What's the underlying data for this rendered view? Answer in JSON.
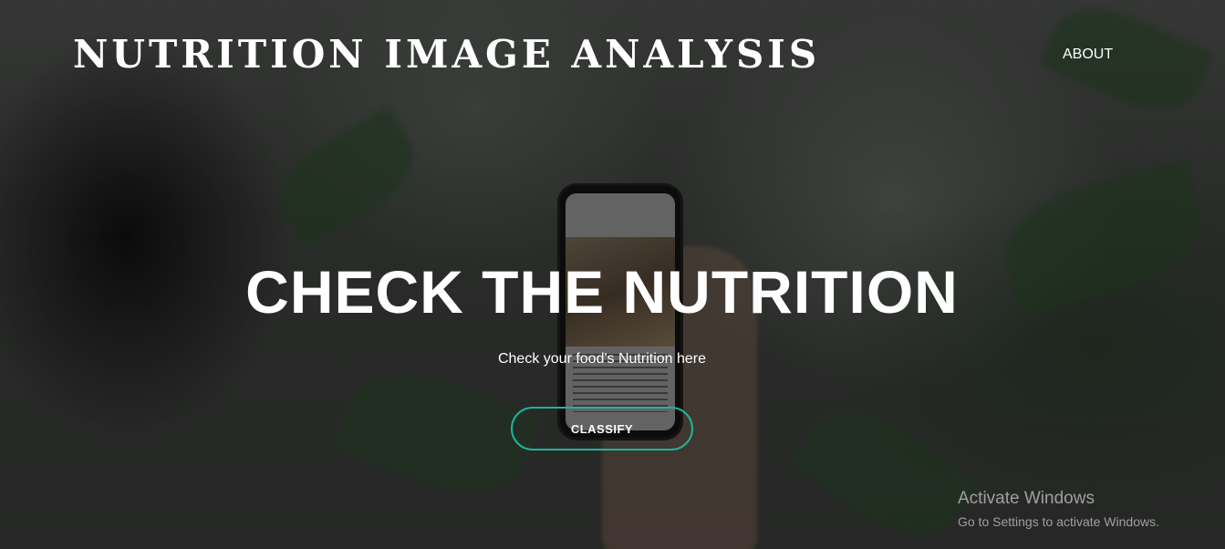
{
  "header": {
    "brand": "NUTRITION IMAGE ANALYSIS",
    "nav": {
      "about_label": "ABOUT"
    }
  },
  "hero": {
    "title": "CHECK THE NUTRITION",
    "subtitle": "Check your food's Nutrition here",
    "classify_label": "CLASSIFY"
  },
  "watermark": {
    "title": "Activate Windows",
    "subtitle": "Go to Settings to activate Windows."
  },
  "colors": {
    "accent": "#1eb49a",
    "text": "#ffffff"
  }
}
